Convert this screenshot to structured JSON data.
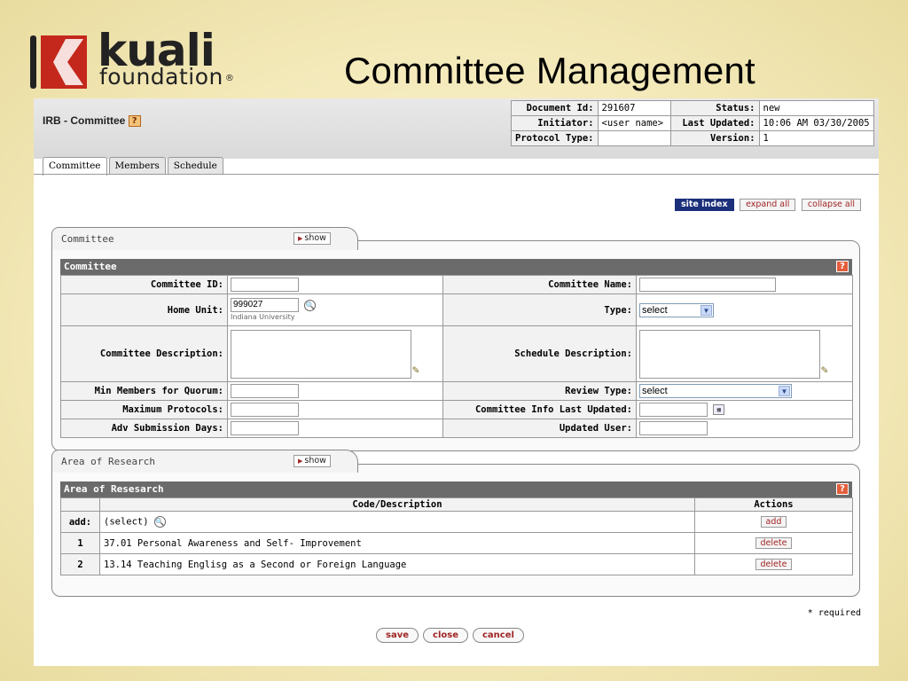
{
  "slide": {
    "title": "Committee Management"
  },
  "logo": {
    "word": "kuali",
    "sub": "foundation",
    "reg": "®"
  },
  "page": {
    "title": "IRB - Committee",
    "help": "?"
  },
  "doc_info": {
    "document_id_label": "Document Id:",
    "document_id": "291607",
    "status_label": "Status:",
    "status": "new",
    "initiator_label": "Initiator:",
    "initiator": "<user name>",
    "last_updated_label": "Last Updated:",
    "last_updated": "10:06 AM 03/30/2005",
    "protocol_type_label": "Protocol Type:",
    "protocol_type": "",
    "version_label": "Version:",
    "version": "1"
  },
  "tabs": [
    {
      "label": "Committee",
      "active": true
    },
    {
      "label": "Members",
      "active": false
    },
    {
      "label": "Schedule",
      "active": false
    }
  ],
  "top_buttons": {
    "site_index": "site index",
    "expand_all": "expand all",
    "collapse_all": "collapse all"
  },
  "committee_section": {
    "tab_title": "Committee",
    "show": "show",
    "header": "Committee",
    "labels": {
      "committee_id": "Committee ID:",
      "committee_name": "Committee Name:",
      "home_unit": "Home Unit:",
      "type": "Type:",
      "committee_description": "Committee Description:",
      "schedule_description": "Schedule Description:",
      "min_members": "Min Members for Quorum:",
      "review_type": "Review Type:",
      "max_protocols": "Maximum Protocols:",
      "info_last_updated": "Committee Info Last Updated:",
      "adv_submission_days": "Adv Submission Days:",
      "updated_user": "Updated User:"
    },
    "values": {
      "home_unit": "999027",
      "home_unit_name": "Indiana University",
      "type": "select",
      "review_type": "select"
    }
  },
  "research_section": {
    "tab_title": "Area of Research",
    "show": "show",
    "header": "Area of Resesarch",
    "columns": {
      "code": "Code/Description",
      "actions": "Actions"
    },
    "add_label": "add:",
    "add_placeholder": "(select)",
    "add_button": "add",
    "rows": [
      {
        "num": "1",
        "desc": "37.01 Personal Awareness and Self- Improvement",
        "action": "delete"
      },
      {
        "num": "2",
        "desc": "13.14 Teaching Englisg as a Second or Foreign Language",
        "action": "delete"
      }
    ]
  },
  "footer": {
    "required": "* required",
    "save": "save",
    "close": "close",
    "cancel": "cancel"
  },
  "colors": {
    "accent": "#1b2f7a",
    "link_red": "#a02424",
    "panel_header": "#6b6b6b",
    "logo_red": "#c4281c"
  }
}
